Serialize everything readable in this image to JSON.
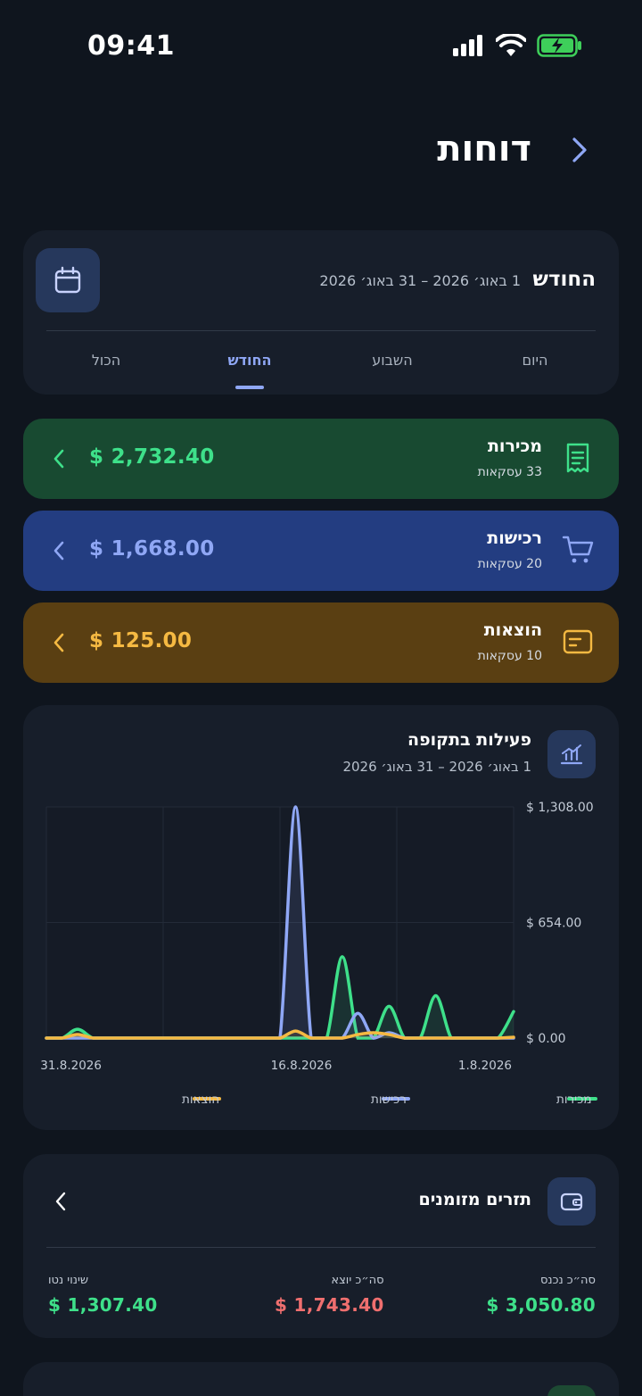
{
  "status_bar": {
    "time": "09:41"
  },
  "header": {
    "title": "דוחות"
  },
  "period": {
    "label": "החודש",
    "range": "1 באוג׳ 2026 – 31 באוג׳ 2026",
    "tabs": [
      "היום",
      "השבוע",
      "החודש",
      "הכול"
    ],
    "active_tab": "החודש"
  },
  "summaries": [
    {
      "title": "מכירות",
      "count": "33 עסקאות",
      "amount": "$ 2,732.40",
      "color": "#3ee08a",
      "bg": "#184a31"
    },
    {
      "title": "רכישות",
      "count": "20 עסקאות",
      "amount": "$ 1,668.00",
      "color": "#8fa7f5",
      "bg": "#233d81"
    },
    {
      "title": "הוצאות",
      "count": "10 עסקאות",
      "amount": "$ 125.00",
      "color": "#f5b942",
      "bg": "#5a3f12"
    }
  ],
  "activity": {
    "title": "פעילות בתקופה",
    "subtitle": "1 באוג׳ 2026 – 31 באוג׳ 2026"
  },
  "chart_data": {
    "type": "line",
    "x": [
      "1.8.2026",
      "2.8.2026",
      "3.8.2026",
      "4.8.2026",
      "5.8.2026",
      "6.8.2026",
      "7.8.2026",
      "8.8.2026",
      "9.8.2026",
      "10.8.2026",
      "11.8.2026",
      "12.8.2026",
      "13.8.2026",
      "14.8.2026",
      "15.8.2026",
      "16.8.2026",
      "17.8.2026",
      "18.8.2026",
      "19.8.2026",
      "20.8.2026",
      "21.8.2026",
      "22.8.2026",
      "23.8.2026",
      "24.8.2026",
      "25.8.2026",
      "26.8.2026",
      "27.8.2026",
      "28.8.2026",
      "29.8.2026",
      "30.8.2026",
      "31.8.2026"
    ],
    "x_axis_reversed": true,
    "xticks": [
      "1.8.2026",
      "16.8.2026",
      "31.8.2026"
    ],
    "yticks": [
      "$ 1,308.00",
      "$ 654.00",
      "$ 0.00"
    ],
    "ylim": [
      0,
      1308
    ],
    "series": [
      {
        "name": "מכירות",
        "color": "#3ee08a",
        "values": [
          150,
          0,
          0,
          0,
          0,
          240,
          0,
          0,
          180,
          0,
          0,
          460,
          0,
          0,
          0,
          0,
          0,
          0,
          0,
          0,
          0,
          0,
          0,
          0,
          0,
          0,
          0,
          0,
          50,
          0,
          0
        ]
      },
      {
        "name": "רכישות",
        "color": "#8fa7f5",
        "values": [
          0,
          0,
          0,
          0,
          0,
          0,
          0,
          0,
          30,
          0,
          140,
          0,
          0,
          0,
          1308,
          0,
          0,
          0,
          0,
          0,
          0,
          0,
          0,
          0,
          0,
          0,
          0,
          0,
          0,
          0,
          0
        ]
      },
      {
        "name": "הוצאות",
        "color": "#f5b942",
        "values": [
          5,
          0,
          0,
          0,
          0,
          0,
          0,
          0,
          20,
          30,
          20,
          0,
          0,
          0,
          40,
          0,
          0,
          0,
          0,
          0,
          0,
          0,
          0,
          0,
          0,
          0,
          0,
          0,
          20,
          0,
          0
        ]
      }
    ],
    "grid": true,
    "legend_placement": "bottom"
  },
  "cashflow": {
    "title": "תזרים מזומנים",
    "in_label": "סה״כ נכנס",
    "in_value": "$ 3,050.80",
    "out_label": "סה״כ יוצא",
    "out_value": "$ 1,743.40",
    "net_label": "שינוי נטו",
    "net_value": "$ 1,307.40"
  },
  "colors": {
    "positive": "#3ee08a",
    "negative": "#f06f6f",
    "accent": "#8fa7f5"
  }
}
